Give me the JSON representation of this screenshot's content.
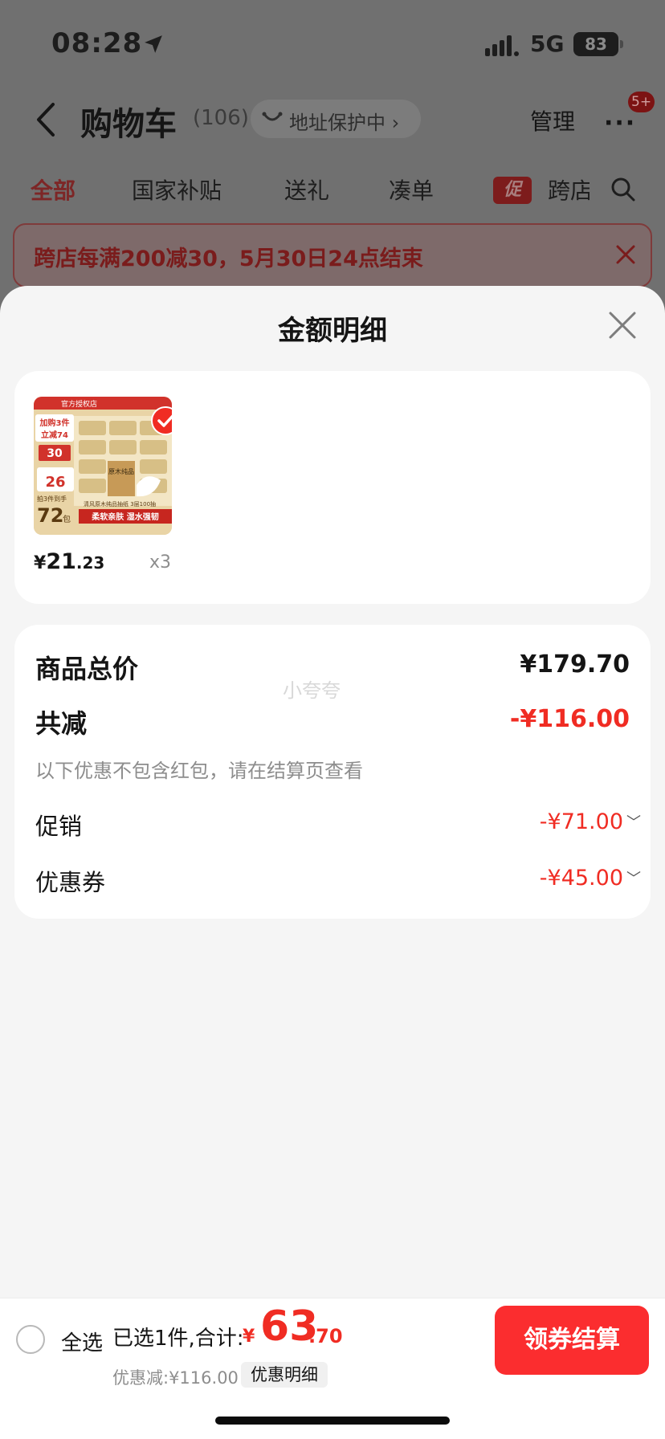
{
  "status_bar": {
    "time": "08:28",
    "network": "5G",
    "battery": "83"
  },
  "nav": {
    "title": "购物车",
    "count": "(106)",
    "address_protect": "地址保护中 ›",
    "manage": "管理",
    "more": "···",
    "badge": "5+"
  },
  "tabs": [
    {
      "label": "全部",
      "active": true
    },
    {
      "label": "国家补贴"
    },
    {
      "label": "送礼"
    },
    {
      "label": "凑单"
    },
    {
      "label": "跨店"
    }
  ],
  "promo_tag": "促",
  "banner": {
    "text": "跨店每满200减30，5月30日24点结束"
  },
  "sheet": {
    "title": "金额明细",
    "product": {
      "price_currency": "¥",
      "price_int": "21",
      "price_dec": ".23",
      "quantity": "x3",
      "selected": true,
      "image_text": {
        "shop": "官方授权店",
        "promo_line1": "加购3件",
        "promo_line2": "立减74",
        "coupon": "30",
        "price": "26",
        "count": "72",
        "count_unit": "包",
        "count_label": "拍3件到手",
        "desc": "清风原木纯品抽纸 3层100抽",
        "slogan": "柔软亲肤 湿水强韧",
        "box_text": "原木纯品"
      }
    },
    "summary": {
      "total_label": "商品总价",
      "total_value": "¥179.70",
      "reduce_label": "共减",
      "reduce_value": "-¥116.00",
      "note": "以下优惠不包含红包，请在结算页查看",
      "promo_label": "促销",
      "promo_value": "-¥71.00",
      "coupon_label": "优惠券",
      "coupon_value": "-¥45.00",
      "watermark": "小夸夸"
    }
  },
  "checkout": {
    "select_all": "全选",
    "selected_text": "已选1件,合计:",
    "total_currency": "¥",
    "total_int": "63",
    "total_dec": ".70",
    "discount_text": "优惠减:¥116.00",
    "detail_chip": "优惠明细",
    "button": "领券结算"
  },
  "colors": {
    "accent": "#f02c23",
    "button": "#fb2d2f",
    "sheet_bg": "#f5f5f5"
  }
}
